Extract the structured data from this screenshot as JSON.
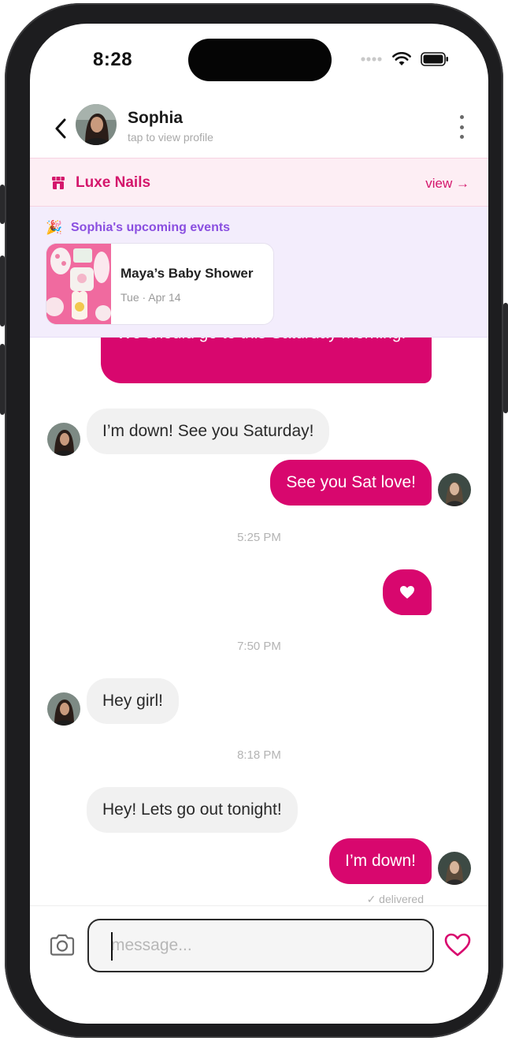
{
  "status_bar": {
    "time": "8:28"
  },
  "header": {
    "back_icon": "chevron-left-icon",
    "name": "Sophia",
    "subtitle": "tap to view profile",
    "more_icon": "more-vertical-icon"
  },
  "business_banner": {
    "icon": "storefront-icon",
    "name": "Luxe Nails",
    "view_label": "view →"
  },
  "events": {
    "emoji": "🎉",
    "title": "Sophia's upcoming events",
    "cards": [
      {
        "name": "Maya’s Baby Shower",
        "date": "Tue · Apr 14"
      }
    ]
  },
  "messages": [
    {
      "direction": "out",
      "text": "We should go to this Saturday morning!"
    },
    {
      "direction": "in",
      "text": "I’m down! See you Saturday!"
    },
    {
      "direction": "out",
      "text": "See you Sat love!"
    },
    {
      "type": "timestamp",
      "text": "5:25 PM"
    },
    {
      "direction": "out",
      "icon": "heart-icon"
    },
    {
      "type": "timestamp",
      "text": "7:50 PM"
    },
    {
      "direction": "in",
      "text": "Hey girl!"
    },
    {
      "type": "timestamp",
      "text": "8:18 PM"
    },
    {
      "direction": "in",
      "text": "Hey! Lets go out tonight!"
    },
    {
      "direction": "out",
      "text": "I’m down!"
    }
  ],
  "delivered_label": "✓ delivered",
  "composer": {
    "camera_icon": "camera-icon",
    "placeholder": "message...",
    "send_icon": "heart-outline-icon"
  },
  "colors": {
    "accent": "#d8076e",
    "banner_bg": "#fdeef4",
    "events_bg": "#f3edfc",
    "events_title": "#8a4fe0",
    "bubble_in": "#f1f1f1"
  }
}
